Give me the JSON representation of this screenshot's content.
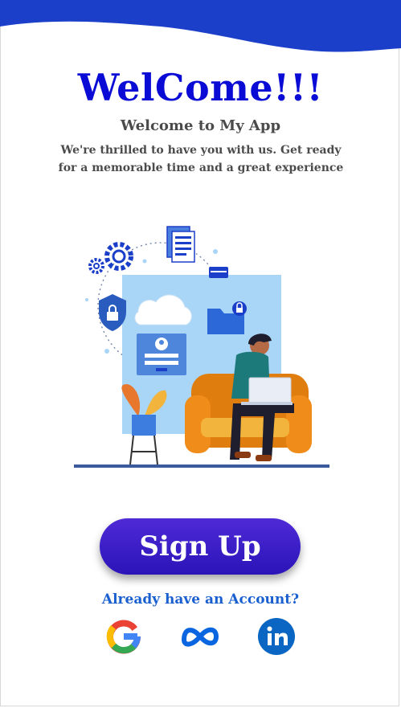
{
  "header": {
    "title": "WelCome!!!",
    "subtitle": "Welcome to My App",
    "description": "We're thrilled to have you with us. Get ready for a memorable time and a great experience"
  },
  "illustration": {
    "icon": "person-with-laptop-security-illustration"
  },
  "actions": {
    "signup_label": "Sign Up",
    "login_prompt": "Already have an Account?"
  },
  "social": [
    {
      "name": "Google",
      "icon": "google-icon"
    },
    {
      "name": "Meta",
      "icon": "meta-icon"
    },
    {
      "name": "LinkedIn",
      "icon": "linkedin-icon"
    }
  ],
  "colors": {
    "accent": "#1b3fc9",
    "title": "#0b0bd6",
    "button": "#3a1fc7",
    "link": "#1a5fcf"
  }
}
